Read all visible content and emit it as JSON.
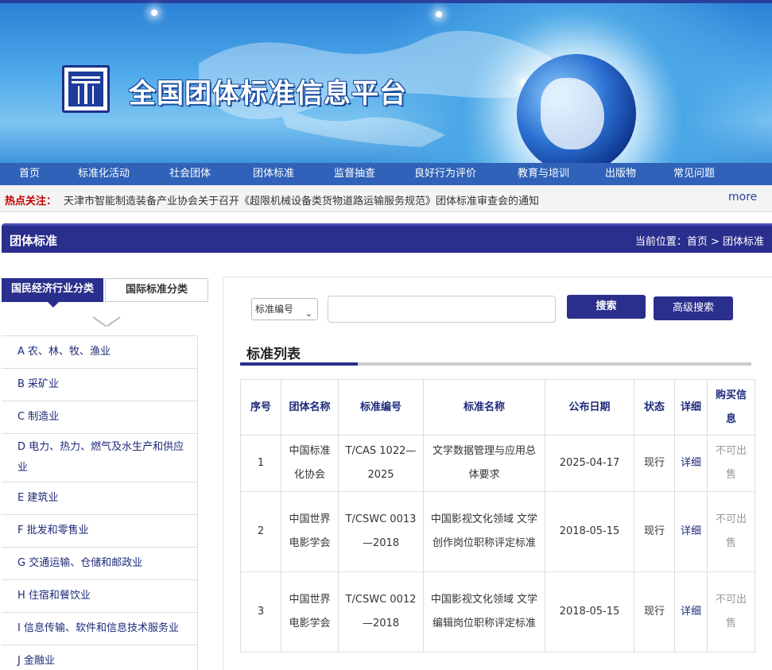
{
  "site": {
    "title": "全国团体标准信息平台"
  },
  "nav": {
    "items": [
      "首页",
      "标准化活动",
      "社会团体",
      "团体标准",
      "监督抽查",
      "良好行为评价",
      "教育与培训",
      "出版物",
      "常见问题"
    ]
  },
  "hot": {
    "label": "热点关注：",
    "text": "天津市智能制造装备产业协会关于召开《超限机械设备类货物道路运输服务规范》团体标准审查会的通知",
    "more": "more"
  },
  "section": {
    "title": "团体标准",
    "breadcrumb": "当前位置：首页 > 团体标准"
  },
  "categories": {
    "tabs": [
      "国民经济行业分类",
      "国际标准分类"
    ],
    "items": [
      "A 农、林、牧、渔业",
      "B 采矿业",
      "C 制造业",
      "D 电力、热力、燃气及水生产和供应业",
      "E 建筑业",
      "F 批发和零售业",
      "G 交通运输、仓储和邮政业",
      "H 住宿和餐饮业",
      "I 信息传输、软件和信息技术服务业",
      "J 金融业"
    ]
  },
  "search": {
    "select_value": "标准编号",
    "input_value": "",
    "search_label": "搜索",
    "advanced_label": "高级搜索"
  },
  "list": {
    "title": "标准列表",
    "columns": [
      "序号",
      "团体名称",
      "标准编号",
      "标准名称",
      "公布日期",
      "状态",
      "详细",
      "购买信息"
    ],
    "rows": [
      [
        "1",
        "中国标准化协会",
        "T/CAS 1022—2025",
        "文学数据管理与应用总体要求",
        "2025-04-17",
        "现行",
        "详细",
        "不可出售"
      ],
      [
        "2",
        "中国世界电影学会",
        "T/CSWC 0013—2018",
        "中国影视文化领域 文学创作岗位职称评定标准",
        "2018-05-15",
        "现行",
        "详细",
        "不可出售"
      ],
      [
        "3",
        "中国世界电影学会",
        "T/CSWC 0012—2018",
        "中国影视文化领域 文学编辑岗位职称评定标准",
        "2018-05-15",
        "现行",
        "详细",
        "不可出售"
      ]
    ]
  },
  "colors": {
    "primary": "#2a2e8d",
    "nav": "#2f62b8",
    "hot_label": "#c00000"
  },
  "icons": {
    "logo": "logo-t-icon",
    "select": "chevron-down-icon",
    "collapse": "chevron-down-icon"
  }
}
